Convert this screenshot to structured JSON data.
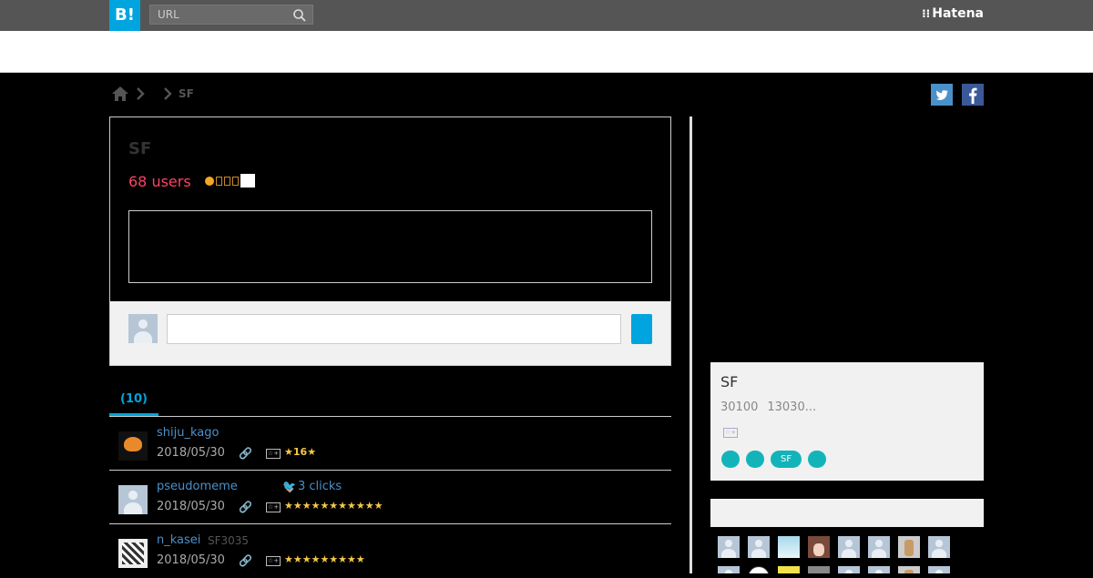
{
  "header": {
    "logo_text": "B!",
    "search_placeholder": "URL",
    "brand": "Hatena",
    "brand_mark": "⁝⁝"
  },
  "breadcrumb": {
    "current": "SF"
  },
  "entry": {
    "title": "SF",
    "users": "68 users"
  },
  "tabs": [
    {
      "label": "(10)"
    }
  ],
  "bookmarks": [
    {
      "user": "shiju_kago",
      "date": "2018/05/30",
      "stars": "★",
      "star_count": "16",
      "star_suffix": "★"
    },
    {
      "user": "pseudomeme",
      "date": "2018/05/30",
      "clicks": "3 clicks",
      "stars": "★★★★★★★★★★★"
    },
    {
      "user": "n_kasei",
      "note": "SF3035",
      "date": "2018/05/30",
      "stars": "★★★★★★★★★"
    }
  ],
  "sidebar": {
    "title": "SF",
    "stat_1": "30100",
    "stat_2": "13030...",
    "tag_label": "SF"
  },
  "colors": {
    "accent": "#00a4de",
    "users_count": "#ff4166",
    "tag": "#13b4b9",
    "star": "#f5c84a"
  }
}
